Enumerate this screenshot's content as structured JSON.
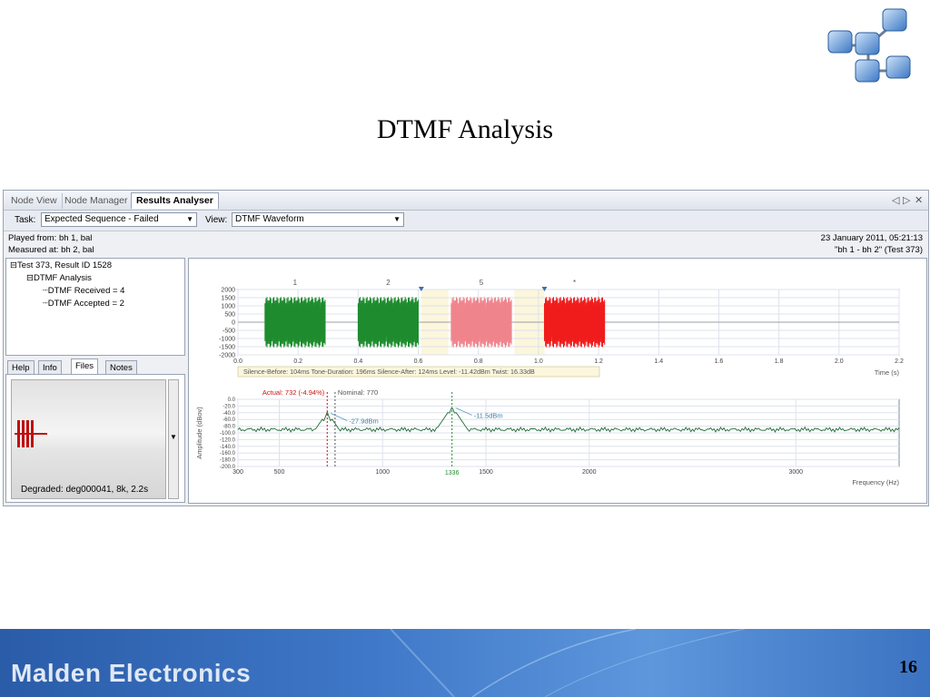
{
  "slide": {
    "title": "DTMF Analysis",
    "page_number": "16",
    "brand": "Malden Electronics"
  },
  "app": {
    "tabs": [
      {
        "label": "Node View",
        "active": false
      },
      {
        "label": "Node Manager",
        "active": false
      },
      {
        "label": "Results Analyser",
        "active": true
      }
    ],
    "toolbar": {
      "task_label": "Task:",
      "task_value": "Expected Sequence - Failed",
      "view_label": "View:",
      "view_value": "DTMF Waveform"
    },
    "played_from": "Played from: bh 1, bal",
    "measured_at": "Measured at: bh 2, bal",
    "datetime": "23 January 2011, 05:21:13",
    "test_name": "\"bh 1 - bh 2\" (Test 373)",
    "tree": {
      "root": "Test 373, Result ID 1528",
      "child": "DTMF Analysis",
      "leaves": [
        "DTMF Received = 4",
        "DTMF Accepted = 2"
      ]
    },
    "subtabs": [
      {
        "label": "Help",
        "active": false
      },
      {
        "label": "Info",
        "active": false
      },
      {
        "label": "Files",
        "active": true
      },
      {
        "label": "Notes",
        "active": false
      }
    ],
    "file_caption": "Degraded: deg000041, 8k, 2.2s"
  },
  "chart_data": [
    {
      "type": "area",
      "xlabel": "Time (s)",
      "ylabel": "",
      "xlim": [
        0.0,
        2.2
      ],
      "ylim": [
        -2000,
        2000
      ],
      "x_ticks": [
        "0.0",
        "0.2",
        "0.4",
        "0.6",
        "0.8",
        "1.0",
        "1.2",
        "1.4",
        "1.6",
        "1.8",
        "2.0",
        "2.2"
      ],
      "y_ticks": [
        "2000",
        "1500",
        "1000",
        "500",
        "0",
        "-500",
        "-1000",
        "-1500",
        "-2000"
      ],
      "grid": true,
      "tones": [
        {
          "label": "1",
          "start": 0.09,
          "end": 0.29,
          "amplitude": 1550,
          "color": "#1e8c2e"
        },
        {
          "label": "2",
          "start": 0.4,
          "end": 0.6,
          "amplitude": 1550,
          "color": "#1e8c2e"
        },
        {
          "label": "5",
          "start": 0.71,
          "end": 0.91,
          "amplitude": 1550,
          "color": "#f0848c"
        },
        {
          "label": "*",
          "start": 1.02,
          "end": 1.22,
          "amplitude": 1550,
          "color": "#f01c1c"
        }
      ],
      "silence_regions": [
        [
          0.61,
          0.7
        ],
        [
          0.92,
          1.02
        ]
      ],
      "markers": [
        0.61,
        1.02
      ],
      "annotation": "Silence-Before: 104ms   Tone-Duration: 196ms   Silence-After: 124ms   Level: -11.42dBm   Twist: 16.33dB"
    },
    {
      "type": "line",
      "xlabel": "Frequency (Hz)",
      "ylabel": "Amplitude (dBov)",
      "xlim": [
        300,
        3500
      ],
      "ylim": [
        -200,
        0
      ],
      "x_ticks": [
        "300",
        "500",
        "1000",
        "1500",
        "2000",
        "3000"
      ],
      "x_tick_values": [
        300,
        500,
        1000,
        1500,
        2000,
        3000
      ],
      "y_ticks": [
        "0.0",
        "-20.0",
        "-40.0",
        "-60.0",
        "-80.0",
        "-100.0",
        "-120.0",
        "-140.0",
        "-160.0",
        "-180.0",
        "-200.0"
      ],
      "grid": true,
      "peaks": [
        {
          "freq": 732,
          "level": -27.9,
          "label": "-27.9dBm"
        },
        {
          "freq": 1336,
          "level": -11.5,
          "label": "-11.5dBm"
        }
      ],
      "baseline": -90,
      "annotations": {
        "actual": "Actual: 732 (-4.94%)",
        "nominal": "Nominal: 770",
        "marker": "1336"
      },
      "actual_freq": 732,
      "nominal_freq": 770,
      "marker_freq": 1336
    }
  ]
}
